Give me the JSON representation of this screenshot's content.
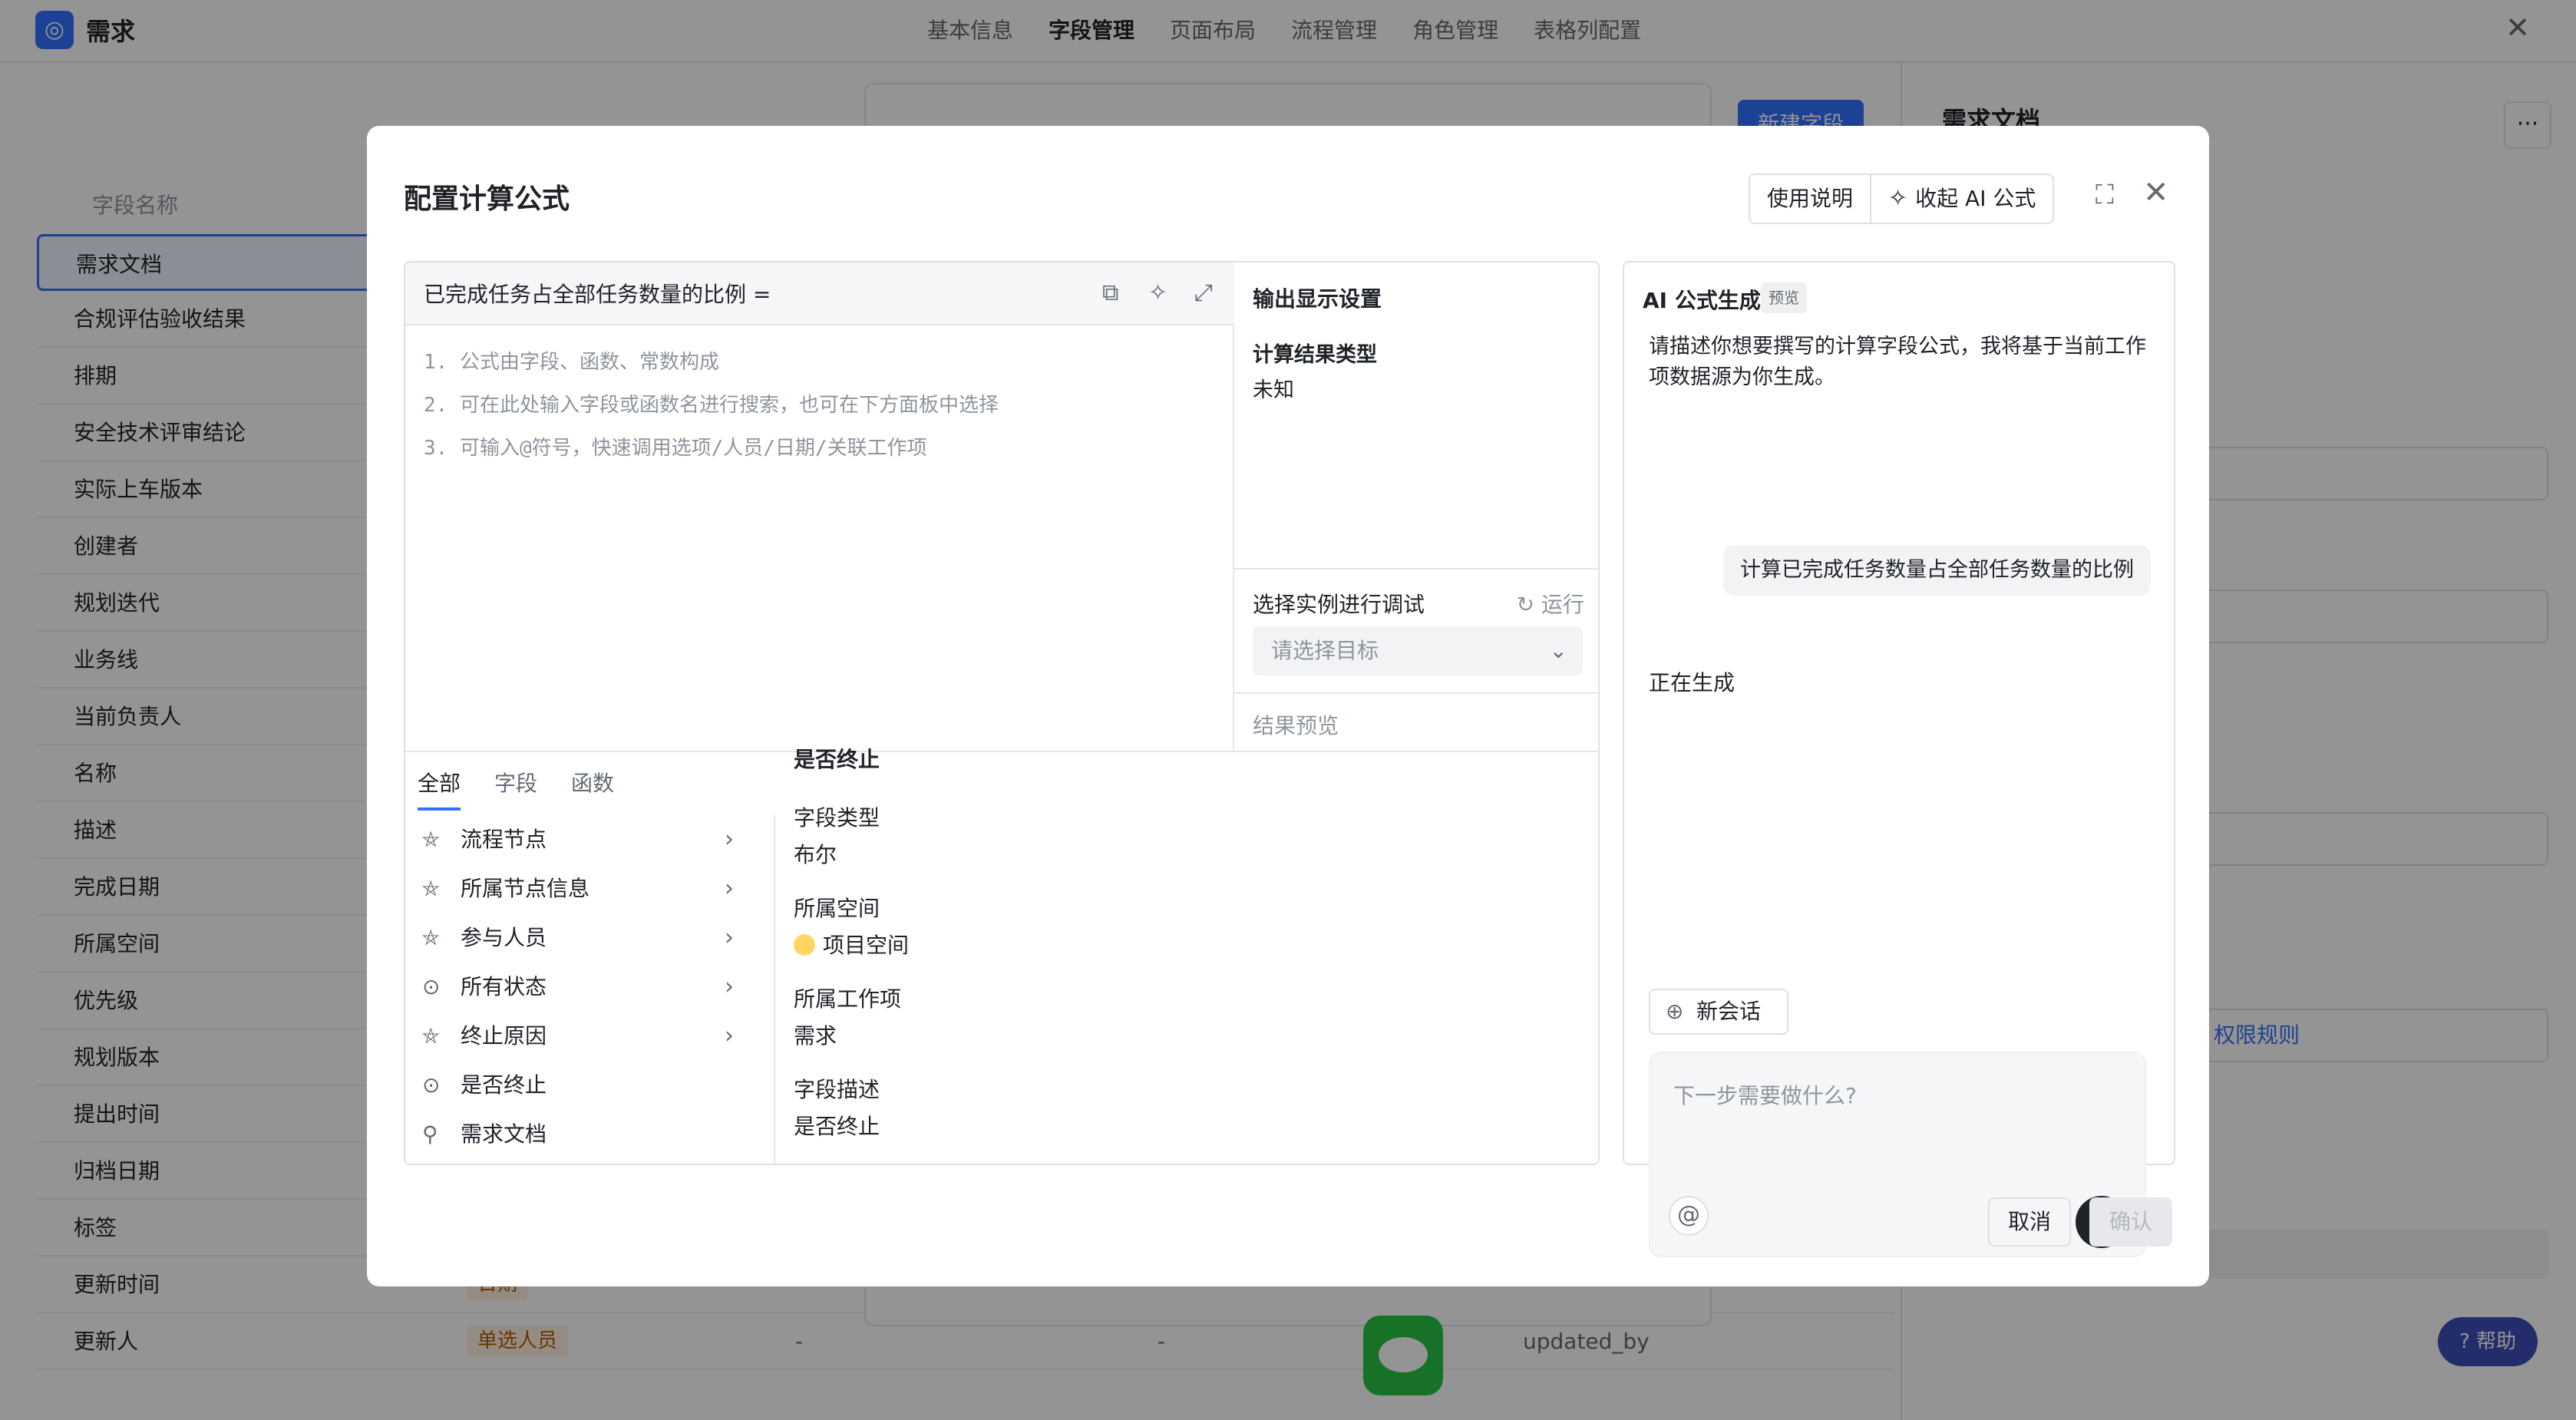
{
  "app": {
    "title": "需求"
  },
  "nav": {
    "tabs": [
      "基本信息",
      "字段管理",
      "页面布局",
      "流程管理",
      "角色管理",
      "表格列配置"
    ],
    "active": "字段管理"
  },
  "field_list": {
    "header": "字段名称",
    "rows": [
      {
        "name": "需求文档",
        "selected": true
      },
      {
        "name": "合规评估验收结果"
      },
      {
        "name": "排期"
      },
      {
        "name": "安全技术评审结论"
      },
      {
        "name": "实际上车版本"
      },
      {
        "name": "创建者"
      },
      {
        "name": "规划迭代"
      },
      {
        "name": "业务线"
      },
      {
        "name": "当前负责人"
      },
      {
        "name": "名称"
      },
      {
        "name": "描述"
      },
      {
        "name": "完成日期"
      },
      {
        "name": "所属空间"
      },
      {
        "name": "优先级"
      },
      {
        "name": "规划版本"
      },
      {
        "name": "提出时间"
      },
      {
        "name": "归档日期"
      },
      {
        "name": "标签"
      },
      {
        "name": "更新时间",
        "type": "日期"
      },
      {
        "name": "更新人",
        "type": "单选人员",
        "c1": "-",
        "c2": "-",
        "c3": "updated_by"
      }
    ]
  },
  "background": {
    "new_field_button": "新建字段",
    "right_panel_title": "需求文档",
    "right_panel_more": "···",
    "permission_link": "权限规则",
    "help_button": "帮助"
  },
  "modal": {
    "title": "配置计算公式",
    "usage_button": "使用说明",
    "collapse_ai_button": "收起 AI 公式",
    "formula": {
      "field_name": "已完成任务占全部任务数量的比例 =",
      "placeholders": [
        "1. 公式由字段、函数、常数构成",
        "2. 可在此处输入字段或函数名进行搜索，也可在下方面板中选择",
        "3. 可输入@符号，快速调用选项/人员/日期/关联工作项"
      ]
    },
    "output": {
      "title": "输出显示设置",
      "result_type_label": "计算结果类型",
      "result_type_value": "未知",
      "debug_label": "选择实例进行调试",
      "run_button": "运行",
      "target_placeholder": "请选择目标",
      "preview_label": "结果预览"
    },
    "tabs": [
      "全部",
      "字段",
      "函数"
    ],
    "active_tab": "全部",
    "tree_items": [
      {
        "label": "流程节点",
        "icon": "flow-icon",
        "has_children": true
      },
      {
        "label": "所属节点信息",
        "icon": "flow-icon",
        "has_children": true
      },
      {
        "label": "参与人员",
        "icon": "flow-icon",
        "has_children": true
      },
      {
        "label": "所有状态",
        "icon": "check-circle-icon",
        "has_children": true
      },
      {
        "label": "终止原因",
        "icon": "flow-icon",
        "has_children": true
      },
      {
        "label": "是否终止",
        "icon": "check-circle-icon",
        "has_children": false
      },
      {
        "label": "需求文档",
        "icon": "link-icon",
        "has_children": false
      }
    ],
    "detail": {
      "heading": "是否终止",
      "field_type_label": "字段类型",
      "field_type_value": "布尔",
      "space_label": "所属空间",
      "space_value": "项目空间",
      "workitem_label": "所属工作项",
      "workitem_value": "需求",
      "desc_label": "字段描述",
      "desc_value": "是否终止"
    },
    "ai": {
      "title": "AI 公式生成",
      "badge": "预览",
      "description": "请描述你想要撰写的计算字段公式，我将基于当前工作项数据源为你生成。",
      "user_message": "计算已完成任务数量占全部任务数量的比例",
      "status": "正在生成",
      "new_chat_button": "新会话",
      "input_placeholder": "下一步需要做什么?"
    },
    "cancel_button": "取消",
    "confirm_button": "确认"
  },
  "colors": {
    "accent": "#3370ff",
    "overlay": "rgba(0,0,0,0.42)",
    "stop_button": "#1f2329"
  }
}
